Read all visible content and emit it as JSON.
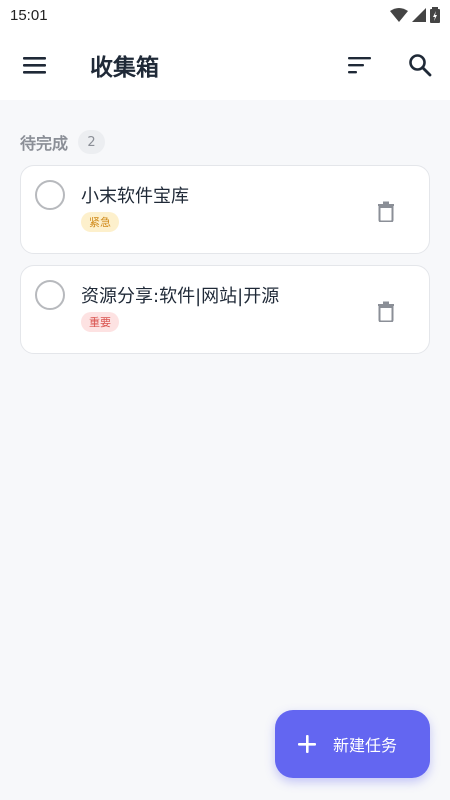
{
  "status_bar": {
    "time": "15:01"
  },
  "app_bar": {
    "title": "收集箱",
    "menu_icon": "menu-icon",
    "sort_icon": "sort-icon",
    "search_icon": "search-icon"
  },
  "section": {
    "title": "待完成",
    "count": "2"
  },
  "tasks": [
    {
      "title": "小末软件宝库",
      "tag": "紧急",
      "tag_color": "#d08a1a",
      "completed": false
    },
    {
      "title": "资源分享:软件|网站|开源",
      "tag": "重要",
      "tag_color": "#d9534f",
      "completed": false
    }
  ],
  "fab": {
    "label": "新建任务",
    "icon": "plus-icon",
    "color": "#6366f1"
  }
}
